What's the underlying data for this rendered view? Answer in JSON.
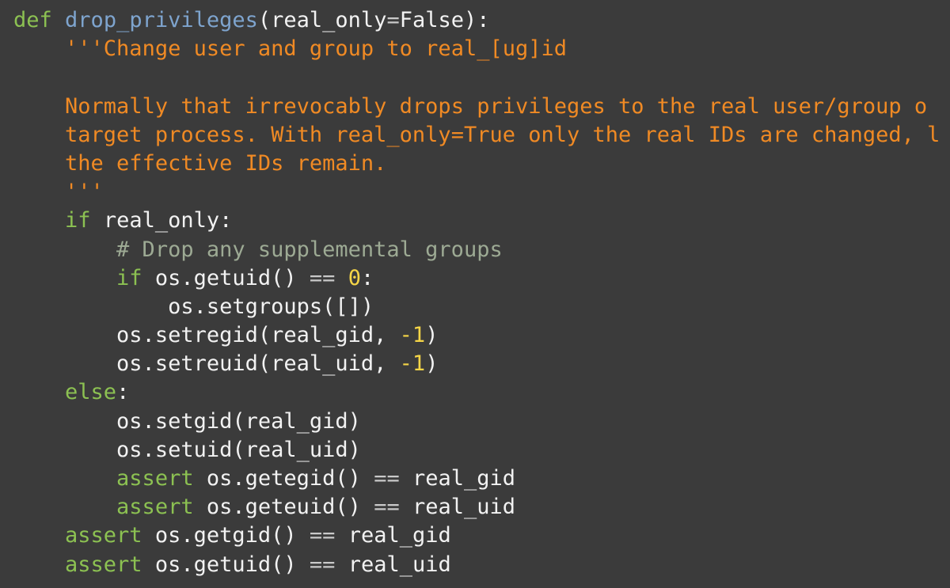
{
  "editor": {
    "background": "#3b3b3b",
    "colors": {
      "keyword": "#8cc152",
      "funcname": "#7ea4ce",
      "string": "#f08a24",
      "comment": "#9daa94",
      "number": "#f5d547",
      "op": "#c9c9c9",
      "name": "#f2f2f2"
    },
    "lines": [
      {
        "tokens": [
          {
            "t": "keyword",
            "v": "def"
          },
          {
            "t": "plain",
            "v": " "
          },
          {
            "t": "funcname",
            "v": "drop_privileges"
          },
          {
            "t": "name",
            "v": "(real_only"
          },
          {
            "t": "op",
            "v": "="
          },
          {
            "t": "name",
            "v": "False):"
          }
        ]
      },
      {
        "tokens": [
          {
            "t": "plain",
            "v": "    "
          },
          {
            "t": "string",
            "v": "'''Change user and group to real_[ug]id"
          }
        ]
      },
      {
        "tokens": []
      },
      {
        "tokens": [
          {
            "t": "plain",
            "v": "    "
          },
          {
            "t": "string",
            "v": "Normally that irrevocably drops privileges to the real user/group o"
          }
        ]
      },
      {
        "tokens": [
          {
            "t": "plain",
            "v": "    "
          },
          {
            "t": "string",
            "v": "target process. With real_only=True only the real IDs are changed, l"
          }
        ]
      },
      {
        "tokens": [
          {
            "t": "plain",
            "v": "    "
          },
          {
            "t": "string",
            "v": "the effective IDs remain."
          }
        ]
      },
      {
        "tokens": [
          {
            "t": "plain",
            "v": "    "
          },
          {
            "t": "string",
            "v": "'''"
          }
        ]
      },
      {
        "tokens": [
          {
            "t": "plain",
            "v": "    "
          },
          {
            "t": "keyword",
            "v": "if"
          },
          {
            "t": "plain",
            "v": " "
          },
          {
            "t": "name",
            "v": "real_only:"
          }
        ]
      },
      {
        "tokens": [
          {
            "t": "plain",
            "v": "        "
          },
          {
            "t": "comment",
            "v": "# Drop any supplemental groups"
          }
        ]
      },
      {
        "tokens": [
          {
            "t": "plain",
            "v": "        "
          },
          {
            "t": "keyword",
            "v": "if"
          },
          {
            "t": "plain",
            "v": " "
          },
          {
            "t": "name",
            "v": "os.getuid()"
          },
          {
            "t": "plain",
            "v": " "
          },
          {
            "t": "op",
            "v": "=="
          },
          {
            "t": "plain",
            "v": " "
          },
          {
            "t": "number",
            "v": "0"
          },
          {
            "t": "name",
            "v": ":"
          }
        ]
      },
      {
        "tokens": [
          {
            "t": "plain",
            "v": "            "
          },
          {
            "t": "name",
            "v": "os.setgroups([])"
          }
        ]
      },
      {
        "tokens": [
          {
            "t": "plain",
            "v": "        "
          },
          {
            "t": "name",
            "v": "os.setregid(real_gid, "
          },
          {
            "t": "number",
            "v": "-1"
          },
          {
            "t": "name",
            "v": ")"
          }
        ]
      },
      {
        "tokens": [
          {
            "t": "plain",
            "v": "        "
          },
          {
            "t": "name",
            "v": "os.setreuid(real_uid, "
          },
          {
            "t": "number",
            "v": "-1"
          },
          {
            "t": "name",
            "v": ")"
          }
        ]
      },
      {
        "tokens": [
          {
            "t": "plain",
            "v": "    "
          },
          {
            "t": "keyword",
            "v": "else"
          },
          {
            "t": "name",
            "v": ":"
          }
        ]
      },
      {
        "tokens": [
          {
            "t": "plain",
            "v": "        "
          },
          {
            "t": "name",
            "v": "os.setgid(real_gid)"
          }
        ]
      },
      {
        "tokens": [
          {
            "t": "plain",
            "v": "        "
          },
          {
            "t": "name",
            "v": "os.setuid(real_uid)"
          }
        ]
      },
      {
        "tokens": [
          {
            "t": "plain",
            "v": "        "
          },
          {
            "t": "keyword",
            "v": "assert"
          },
          {
            "t": "plain",
            "v": " "
          },
          {
            "t": "name",
            "v": "os.getegid()"
          },
          {
            "t": "plain",
            "v": " "
          },
          {
            "t": "op",
            "v": "=="
          },
          {
            "t": "plain",
            "v": " "
          },
          {
            "t": "name",
            "v": "real_gid"
          }
        ]
      },
      {
        "tokens": [
          {
            "t": "plain",
            "v": "        "
          },
          {
            "t": "keyword",
            "v": "assert"
          },
          {
            "t": "plain",
            "v": " "
          },
          {
            "t": "name",
            "v": "os.geteuid()"
          },
          {
            "t": "plain",
            "v": " "
          },
          {
            "t": "op",
            "v": "=="
          },
          {
            "t": "plain",
            "v": " "
          },
          {
            "t": "name",
            "v": "real_uid"
          }
        ]
      },
      {
        "tokens": [
          {
            "t": "plain",
            "v": "    "
          },
          {
            "t": "keyword",
            "v": "assert"
          },
          {
            "t": "plain",
            "v": " "
          },
          {
            "t": "name",
            "v": "os.getgid()"
          },
          {
            "t": "plain",
            "v": " "
          },
          {
            "t": "op",
            "v": "=="
          },
          {
            "t": "plain",
            "v": " "
          },
          {
            "t": "name",
            "v": "real_gid"
          }
        ]
      },
      {
        "tokens": [
          {
            "t": "plain",
            "v": "    "
          },
          {
            "t": "keyword",
            "v": "assert"
          },
          {
            "t": "plain",
            "v": " "
          },
          {
            "t": "name",
            "v": "os.getuid()"
          },
          {
            "t": "plain",
            "v": " "
          },
          {
            "t": "op",
            "v": "=="
          },
          {
            "t": "plain",
            "v": " "
          },
          {
            "t": "name",
            "v": "real_uid"
          }
        ]
      }
    ]
  }
}
